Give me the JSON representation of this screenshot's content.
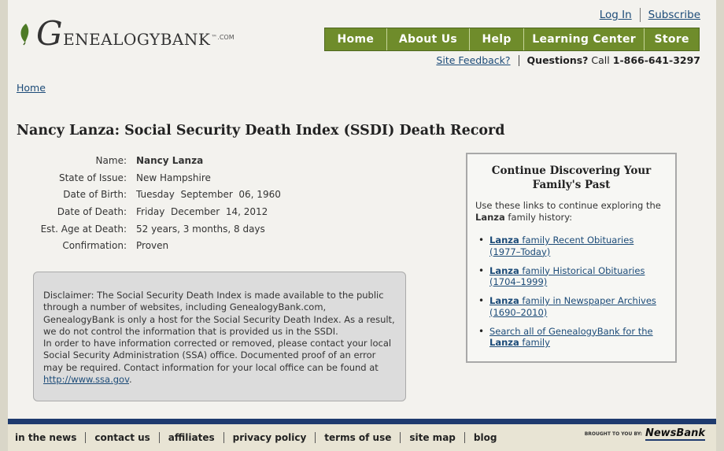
{
  "header": {
    "logo_letter": "G",
    "logo_word": "ENEALOGYBANK",
    "logo_tm": "™",
    "logo_com": ".COM",
    "top_links": {
      "login": "Log In",
      "subscribe": "Subscribe"
    },
    "nav": [
      "Home",
      "About Us",
      "Help",
      "Learning Center",
      "Store"
    ],
    "feedback": "Site Feedback?",
    "questions_label": "Questions?",
    "call_label": "Call",
    "phone": "1-866-641-3297"
  },
  "breadcrumb": "Home",
  "page_title": "Nancy Lanza: Social Security Death Index (SSDI) Death Record",
  "record": [
    {
      "label": "Name:",
      "value": "Nancy Lanza"
    },
    {
      "label": "State of Issue:",
      "value": "New Hampshire"
    },
    {
      "label": "Date of Birth:",
      "value": "Tuesday  September  06, 1960"
    },
    {
      "label": "Date of Death:",
      "value": "Friday  December  14, 2012"
    },
    {
      "label": "Est. Age at Death:",
      "value": "52 years, 3 months, 8 days"
    },
    {
      "label": "Confirmation:",
      "value": "Proven"
    }
  ],
  "disclaimer": {
    "text1": "Disclaimer: The Social Security Death Index is made available to the public through a number of websites, including GenealogyBank.com, GenealogyBank is only a host for the Social Security Death Index. As a result, we do not control the information that is provided us in the SSDI.",
    "text2": "In order to have information corrected or removed, please contact your local Social Security Administration (SSA) office. Documented proof of an error may be required. Contact information for your local office can be found at",
    "link": "http://www.ssa.gov",
    "end": "."
  },
  "discover": {
    "title": "Continue Discovering Your Family's Past",
    "intro_pre": "Use these links to continue exploring the",
    "intro_name": "Lanza",
    "intro_post": "family history:",
    "links": [
      {
        "name": "Lanza",
        "text": "family Recent Obituaries",
        "range": "(1977–Today)"
      },
      {
        "name": "Lanza",
        "text": "family Historical Obituaries",
        "range": "(1704–1999)"
      },
      {
        "name": "Lanza",
        "text": "family in Newspaper Archives",
        "range": "(1690–2010)"
      }
    ],
    "search_pre": "Search all of GenealogyBank for the",
    "search_name": "Lanza",
    "search_post": "family"
  },
  "footer": {
    "links": [
      "in the news",
      "contact us",
      "affiliates",
      "privacy policy",
      "terms of use",
      "site map",
      "blog"
    ],
    "brought_by": "BROUGHT TO YOU BY:",
    "brand": "NewsBank"
  },
  "colors": {
    "nav_green": "#6f8c2b",
    "link_blue": "#1c4b78",
    "footer_blue": "#1e3a6e"
  }
}
